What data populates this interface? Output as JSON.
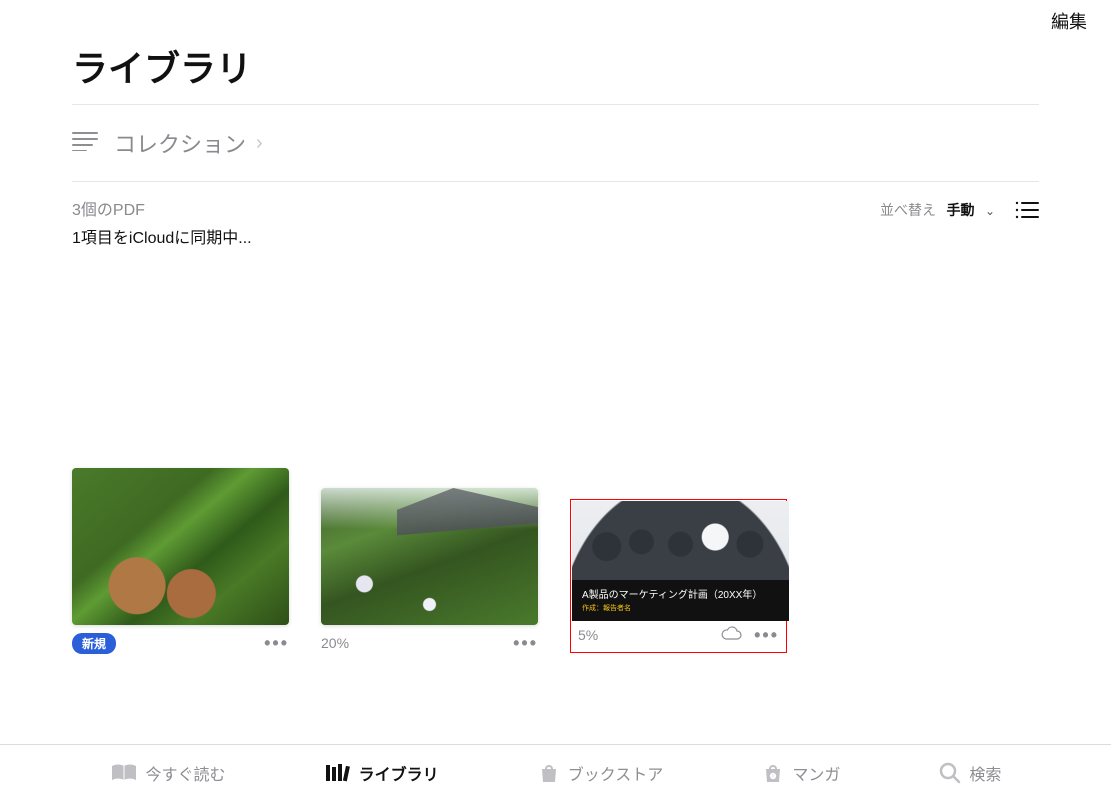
{
  "header": {
    "edit_label": "編集",
    "title": "ライブラリ"
  },
  "collections": {
    "label": "コレクション"
  },
  "meta": {
    "count_text": "3個のPDF",
    "sync_text": "1項目をiCloudに同期中..."
  },
  "sort": {
    "label": "並べ替え",
    "value": "手動"
  },
  "items": [
    {
      "badge": "新規",
      "progress": "",
      "selected": false
    },
    {
      "badge": "",
      "progress": "20%",
      "selected": false
    },
    {
      "badge": "",
      "progress": "5%",
      "selected": true,
      "overlay_title": "A製品のマーケティング計画（20XX年）",
      "overlay_sub": "作成：報告者名"
    }
  ],
  "tabs": {
    "read_now": "今すぐ読む",
    "library": "ライブラリ",
    "bookstore": "ブックストア",
    "manga": "マンガ",
    "search": "検索"
  }
}
